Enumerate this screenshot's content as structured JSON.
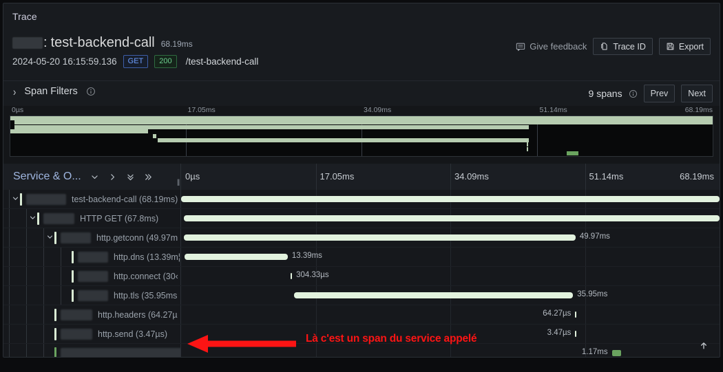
{
  "panel": {
    "title": "Trace"
  },
  "trace_header": {
    "service_redacted": "",
    "separator": ":",
    "operation_name": "test-backend-call",
    "duration": "68.19ms",
    "timestamp": "2024-05-20 16:15:59.136",
    "method": "GET",
    "status": "200",
    "path": "/test-backend-call",
    "feedback_label": "Give feedback",
    "feedback_icon": "comment-icon",
    "trace_id_label": "Trace ID",
    "trace_id_icon": "copy-icon",
    "export_label": "Export",
    "export_icon": "save-icon"
  },
  "span_filters": {
    "expand_icon": "chevron-right-icon",
    "label": "Span Filters",
    "info_icon": "info-circle-icon",
    "spans_count": "9 spans",
    "spans_info_icon": "info-circle-icon",
    "prev_label": "Prev",
    "next_label": "Next"
  },
  "minimap": {
    "ticks": [
      "0µs",
      "17.05ms",
      "34.09ms",
      "51.14ms",
      "68.19ms"
    ],
    "rows": [
      {
        "start_pct": 0.0,
        "width_pct": 100.0,
        "color": "normal"
      },
      {
        "start_pct": 0.55,
        "width_pct": 99.45,
        "color": "normal"
      },
      {
        "start_pct": 0.55,
        "width_pct": 73.3,
        "color": "normal"
      },
      {
        "start_pct": 0.0,
        "width_pct": 19.6,
        "color": "normal"
      },
      {
        "start_pct": 20.3,
        "width_pct": 0.45,
        "color": "normal"
      },
      {
        "start_pct": 21.0,
        "width_pct": 52.8,
        "color": "normal"
      },
      {
        "start_pct": 73.5,
        "width_pct": 0.2,
        "color": "normal"
      },
      {
        "start_pct": 73.5,
        "width_pct": 0.2,
        "color": "normal"
      },
      {
        "start_pct": 79.2,
        "width_pct": 1.7,
        "color": "alt"
      }
    ]
  },
  "timeline_header": {
    "column_label": "Service & O...",
    "icons": [
      "chevron-down-icon",
      "chevron-right-icon",
      "double-chevron-down-icon",
      "double-chevron-right-icon"
    ],
    "drag_handle": "||",
    "ticks": [
      "0µs",
      "17.05ms",
      "34.09ms",
      "51.14ms",
      "68.19ms"
    ]
  },
  "spans": [
    {
      "depth": 0,
      "expanded": true,
      "service_redacted": "",
      "label": "test-backend-call (68.19ms)",
      "start_pct": 0.0,
      "width_pct": 100.0,
      "duration_label": "",
      "label_side": "right",
      "accent": "normal",
      "blur_w": 58
    },
    {
      "depth": 1,
      "expanded": true,
      "service_redacted": "",
      "label": "HTTP GET (67.8ms)",
      "start_pct": 0.55,
      "width_pct": 99.45,
      "duration_label": "",
      "label_side": "right",
      "accent": "normal",
      "blur_w": 45
    },
    {
      "depth": 2,
      "expanded": true,
      "service_redacted": "",
      "label": "http.getconn (49.97m",
      "start_pct": 0.55,
      "width_pct": 72.7,
      "duration_label": "49.97ms",
      "label_side": "right",
      "accent": "normal",
      "blur_w": 44
    },
    {
      "depth": 3,
      "expanded": false,
      "service_redacted": "",
      "label": "http.dns (13.39m¦",
      "start_pct": 0.6,
      "width_pct": 19.2,
      "duration_label": "13.39ms",
      "label_side": "right",
      "accent": "normal",
      "blur_w": 44
    },
    {
      "depth": 3,
      "expanded": false,
      "service_redacted": "",
      "label": "http.connect (30‹",
      "start_pct": 20.3,
      "width_pct": 0.3,
      "duration_label": "304.33µs",
      "label_side": "right",
      "accent": "normal",
      "blur_w": 44
    },
    {
      "depth": 3,
      "expanded": false,
      "service_redacted": "",
      "label": "http.tls (35.95ms",
      "start_pct": 21.0,
      "width_pct": 51.8,
      "duration_label": "35.95ms",
      "label_side": "right",
      "accent": "normal",
      "blur_w": 44
    },
    {
      "depth": 2,
      "expanded": false,
      "service_redacted": "",
      "label": "http.headers (64.27µ",
      "start_pct": 73.2,
      "width_pct": 0.2,
      "duration_label": "64.27µs",
      "label_side": "left",
      "accent": "normal",
      "blur_w": 46
    },
    {
      "depth": 2,
      "expanded": false,
      "service_redacted": "",
      "label": "http.send (3.47µs)",
      "start_pct": 73.2,
      "width_pct": 0.2,
      "duration_label": "3.47µs",
      "label_side": "left",
      "accent": "normal",
      "blur_w": 46
    },
    {
      "depth": 2,
      "expanded": false,
      "service_redacted": "",
      "label": "",
      "start_pct": 80.0,
      "width_pct": 1.7,
      "duration_label": "1.17ms",
      "label_side": "left",
      "accent": "alt",
      "blur_w": 185
    }
  ],
  "scroll_to_top_icon": "arrow-up-icon",
  "annotation": {
    "text": "Là c'est un span du service appelé",
    "color": "#fc1414",
    "arrow": "left-arrow"
  }
}
